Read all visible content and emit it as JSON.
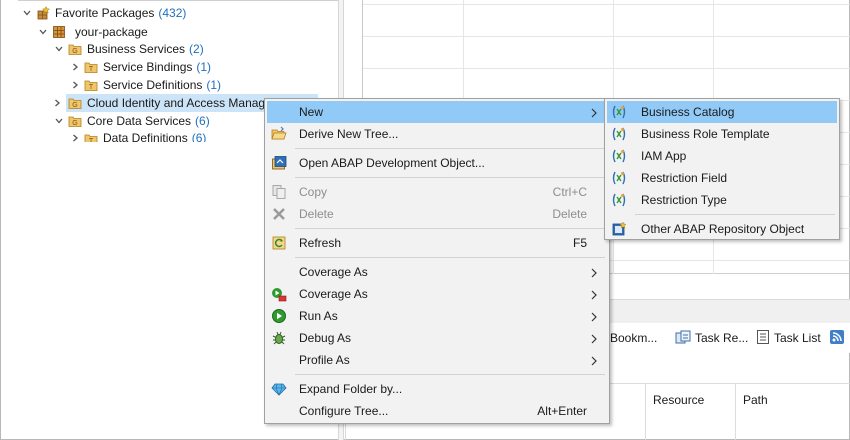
{
  "tree": {
    "items": [
      {
        "label": "Favorite Packages",
        "count": "(432)"
      },
      {
        "label": "your-package",
        "count": ""
      },
      {
        "label": "Business Services",
        "count": "(2)"
      },
      {
        "label": "Service Bindings",
        "count": "(1)"
      },
      {
        "label": "Service Definitions",
        "count": "(1)"
      },
      {
        "label": "Cloud Identity and Access Manag",
        "count": ""
      },
      {
        "label": "Core Data Services",
        "count": "(6)"
      },
      {
        "label": "Data Definitions",
        "count": "(6)"
      }
    ]
  },
  "panel": {
    "tabs": [
      {
        "label": "Bookm..."
      },
      {
        "label": "Task Re..."
      },
      {
        "label": "Task List"
      }
    ],
    "columns": [
      "Resource",
      "Path"
    ]
  },
  "context_menu": {
    "items": [
      {
        "label": "New",
        "shortcut": "",
        "submenu": true
      },
      {
        "label": "Derive New Tree...",
        "shortcut": ""
      },
      {
        "label": "Open ABAP Development Object...",
        "shortcut": ""
      },
      {
        "label": "Copy",
        "shortcut": "Ctrl+C",
        "disabled": true
      },
      {
        "label": "Delete",
        "shortcut": "Delete",
        "disabled": true
      },
      {
        "label": "Refresh",
        "shortcut": "F5"
      },
      {
        "label": "Coverage As",
        "shortcut": "",
        "submenu": true
      },
      {
        "label": "Coverage As",
        "shortcut": "",
        "submenu": true
      },
      {
        "label": "Run As",
        "shortcut": "",
        "submenu": true
      },
      {
        "label": "Debug As",
        "shortcut": "",
        "submenu": true
      },
      {
        "label": "Profile As",
        "shortcut": "",
        "submenu": true
      },
      {
        "label": "Expand Folder by...",
        "shortcut": ""
      },
      {
        "label": "Configure Tree...",
        "shortcut": "Alt+Enter"
      }
    ]
  },
  "new_submenu": {
    "items": [
      {
        "label": "Business Catalog"
      },
      {
        "label": "Business Role Template"
      },
      {
        "label": "IAM App"
      },
      {
        "label": "Restriction Field"
      },
      {
        "label": "Restriction Type"
      },
      {
        "label": "Other ABAP Repository Object"
      }
    ]
  },
  "colors": {
    "selection": "#cce4f7",
    "menu_hover": "#91c9f7",
    "count_blue": "#1f6fbf",
    "folder_orange": "#e8a33a"
  }
}
